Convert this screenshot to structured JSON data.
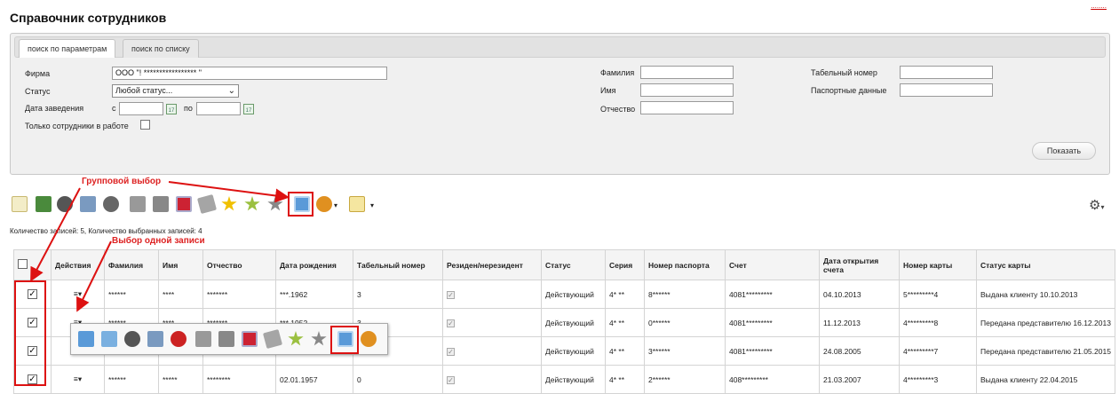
{
  "page": {
    "title": "Справочник сотрудников",
    "top_link": "........"
  },
  "tabs": [
    {
      "label": "поиск по параметрам",
      "active": true
    },
    {
      "label": "поиск по списку",
      "active": false
    }
  ],
  "form": {
    "firm_label": "Фирма",
    "firm_value": "ООО \"! ***************** \"",
    "status_label": "Статус",
    "status_value": "Любой статус...",
    "date_label": "Дата заведения",
    "date_from": "с",
    "date_to": "по",
    "only_working_label": "Только сотрудники в работе",
    "surname_label": "Фамилия",
    "name_label": "Имя",
    "patronymic_label": "Отчество",
    "tab_number_label": "Табельный номер",
    "passport_label": "Паспортные данные",
    "submit": "Показать"
  },
  "annotations": {
    "group": "Групповой выбор",
    "single": "Выбор одной записи"
  },
  "counter": "Количество записей: 5, Количество выбранных записей: 4",
  "table": {
    "headers": [
      "",
      "Действия",
      "Фамилия",
      "Имя",
      "Отчество",
      "Дата рождения",
      "Табельный номер",
      "Резиден/нерезидент",
      "Статус",
      "Серия",
      "Номер паспорта",
      "Счет",
      "Дата открытия счета",
      "Номер карты",
      "Статус карты"
    ],
    "rows": [
      {
        "surname": "******",
        "name": "****",
        "patronymic": "*******",
        "birth": "***.1962",
        "tab": "3",
        "status": "Действующий",
        "series": "4* **",
        "passport": "8******",
        "account": "4081*********",
        "open": "04.10.2013",
        "card": "5*********4",
        "card_status": "Выдана клиенту 10.10.2013"
      },
      {
        "surname": "******",
        "name": "****",
        "patronymic": "*******",
        "birth": "***.1952",
        "tab": "3",
        "status": "Действующий",
        "series": "4* **",
        "passport": "0******",
        "account": "4081*********",
        "open": "11.12.2013",
        "card": "4*********8",
        "card_status": "Передана представителю 16.12.2013"
      },
      {
        "surname": "",
        "name": "",
        "patronymic": "",
        "birth": "",
        "tab": "",
        "status": "Действующий",
        "series": "4* **",
        "passport": "3******",
        "account": "4081*********",
        "open": "24.08.2005",
        "card": "4*********7",
        "card_status": "Передана представителю 21.05.2015"
      },
      {
        "surname": "******",
        "name": "*****",
        "patronymic": "********",
        "birth": "02.01.1957",
        "tab": "0",
        "status": "Действующий",
        "series": "4* **",
        "passport": "2******",
        "account": "408*********",
        "open": "21.03.2007",
        "card": "4*********3",
        "card_status": "Выдана клиенту 22.04.2015"
      }
    ]
  },
  "colors": {
    "accent_red": "#d11111",
    "panel_bg": "#f0f0f0"
  }
}
